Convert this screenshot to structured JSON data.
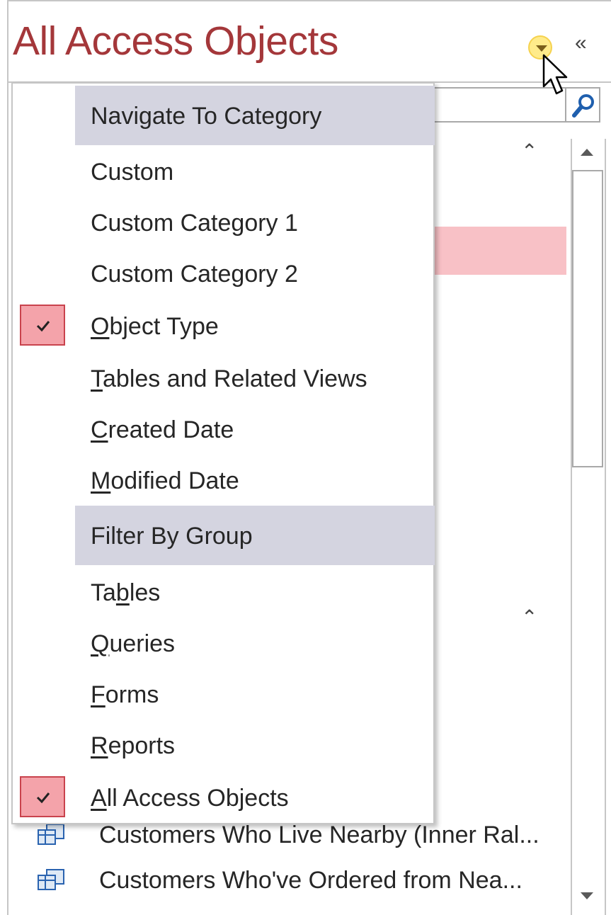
{
  "pane": {
    "title": "All Access Objects"
  },
  "menu": {
    "sections": [
      {
        "header": "Navigate To Category",
        "items": [
          {
            "pre": "",
            "key": "",
            "post": "Custom",
            "checked": false
          },
          {
            "pre": "",
            "key": "",
            "post": "Custom Category 1",
            "checked": false
          },
          {
            "pre": "",
            "key": "",
            "post": "Custom Category 2",
            "checked": false
          },
          {
            "pre": "",
            "key": "O",
            "post": "bject Type",
            "checked": true
          },
          {
            "pre": "",
            "key": "T",
            "post": "ables and Related Views",
            "checked": false
          },
          {
            "pre": "",
            "key": "C",
            "post": "reated Date",
            "checked": false
          },
          {
            "pre": "",
            "key": "M",
            "post": "odified Date",
            "checked": false
          }
        ]
      },
      {
        "header": "Filter By Group",
        "items": [
          {
            "pre": "Ta",
            "key": "b",
            "post": "les",
            "checked": false
          },
          {
            "pre": "",
            "key": "Q",
            "post": "ueries",
            "checked": false
          },
          {
            "pre": "",
            "key": "F",
            "post": "orms",
            "checked": false
          },
          {
            "pre": "",
            "key": "R",
            "post": "eports",
            "checked": false
          },
          {
            "pre": "",
            "key": "A",
            "post": "ll Access Objects",
            "checked": true
          }
        ]
      }
    ]
  },
  "background_list": [
    {
      "label": "Customers Who Live Nearby (Inner Ral...",
      "icon": "query-icon"
    },
    {
      "label": "Customers Who've Ordered from Nea...",
      "icon": "query-icon"
    }
  ],
  "colors": {
    "title": "#a4373a",
    "header_bg": "#d4d4e0",
    "check_bg": "#f4a3aa",
    "check_border": "#c9434d",
    "highlight": "#f8c1c6"
  }
}
